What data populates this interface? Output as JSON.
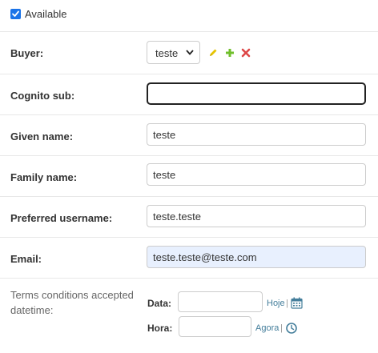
{
  "available": {
    "label": "Available",
    "checked": true
  },
  "buyer": {
    "label": "Buyer:",
    "selected": "teste"
  },
  "cognito_sub": {
    "label": "Cognito sub:",
    "value": ""
  },
  "given_name": {
    "label": "Given name:",
    "value": "teste"
  },
  "family_name": {
    "label": "Family name:",
    "value": "teste"
  },
  "preferred_username": {
    "label": "Preferred username:",
    "value": "teste.teste"
  },
  "email": {
    "label": "Email:",
    "value": "teste.teste@teste.com"
  },
  "terms": {
    "label": "Terms conditions accepted datetime:",
    "date_label": "Data:",
    "date_value": "",
    "today_link": "Hoje",
    "time_label": "Hora:",
    "time_value": "",
    "now_link": "Agora",
    "separator": "|"
  },
  "colors": {
    "checkbox": "#1a73e8",
    "edit_icon": "#e6c400",
    "add_icon": "#70bf2b",
    "delete_icon": "#dd4646",
    "link": "#447e9b",
    "autofill_bg": "#e8f0fe"
  },
  "icons": {
    "edit": "pencil-icon",
    "add": "plus-icon",
    "delete": "x-icon",
    "calendar": "calendar-icon",
    "clock": "clock-icon"
  }
}
